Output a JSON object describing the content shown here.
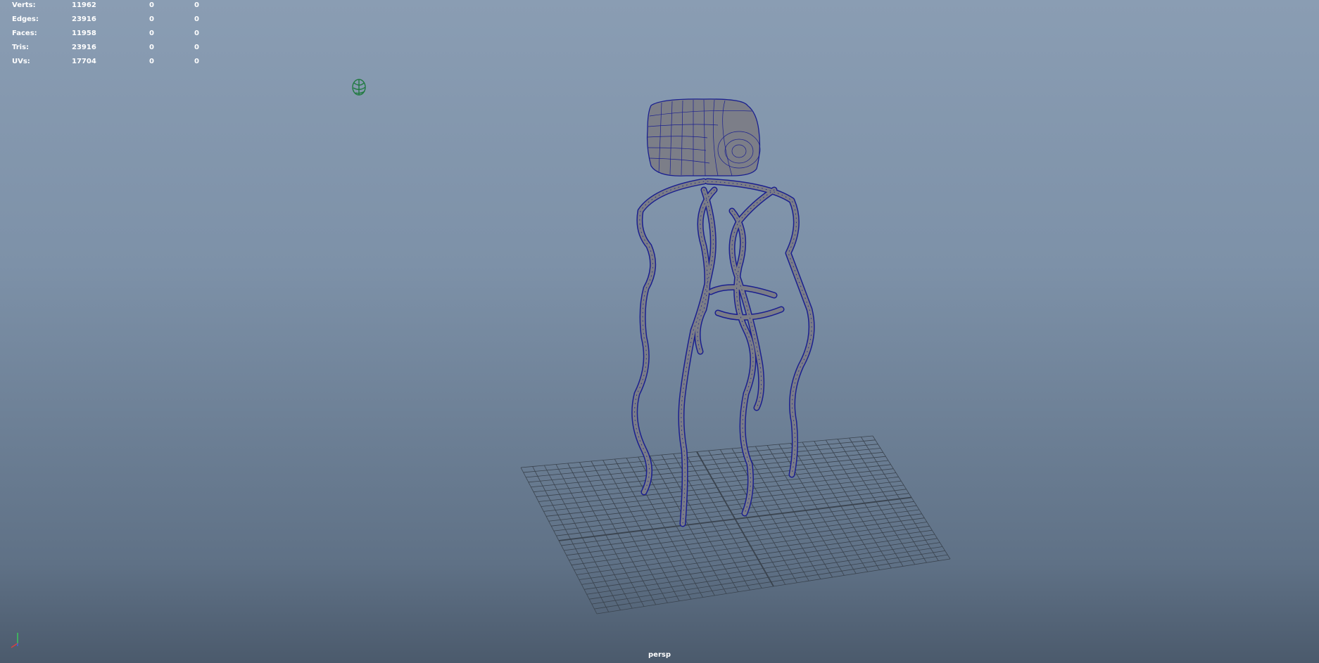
{
  "hud": {
    "rows": [
      {
        "label": "Verts:",
        "values": [
          "11962",
          "0",
          "0"
        ]
      },
      {
        "label": "Edges:",
        "values": [
          "23916",
          "0",
          "0"
        ]
      },
      {
        "label": "Faces:",
        "values": [
          "11958",
          "0",
          "0"
        ]
      },
      {
        "label": "Tris:",
        "values": [
          "23916",
          "0",
          "0"
        ]
      },
      {
        "label": "UVs:",
        "values": [
          "17704",
          "0",
          "0"
        ]
      }
    ]
  },
  "viewport": {
    "camera": "persp"
  },
  "icons": {
    "light": "light-icon",
    "axis": "axis-gizmo-icon"
  },
  "colors": {
    "wire": "#1a1f8f",
    "mesh": "#7b7d87",
    "grid": "#3a434e"
  }
}
